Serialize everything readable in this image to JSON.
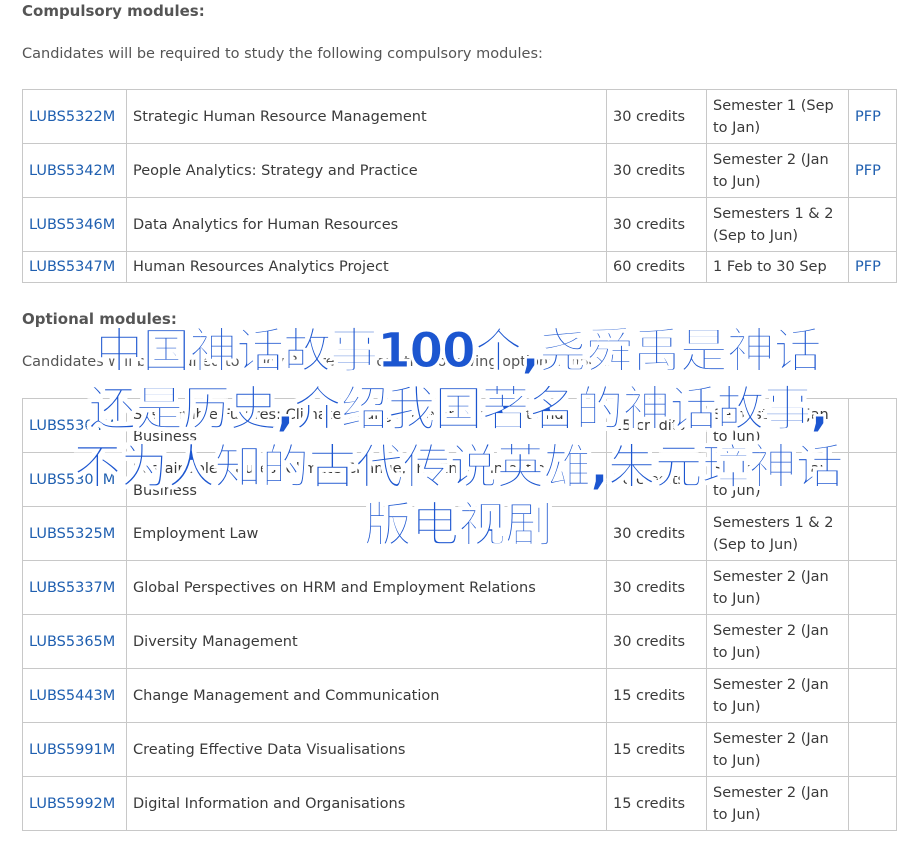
{
  "compulsory": {
    "heading": "Compulsory modules:",
    "intro": "Candidates will be required to study the following compulsory modules:",
    "rows": [
      {
        "code": "LUBS5322M",
        "title": "Strategic Human Resource Management",
        "credits": "30 credits",
        "semester": "Semester 1 (Sep to Jan)",
        "pfp": "PFP"
      },
      {
        "code": "LUBS5342M",
        "title": "People Analytics: Strategy and Practice",
        "credits": "30 credits",
        "semester": "Semester 2 (Jan to Jun)",
        "pfp": "PFP"
      },
      {
        "code": "LUBS5346M",
        "title": "Data Analytics for Human Resources",
        "credits": "30 credits",
        "semester": "Semesters 1 & 2 (Sep to Jun)",
        "pfp": ""
      },
      {
        "code": "LUBS5347M",
        "title": "Human Resources Analytics Project",
        "credits": "60 credits",
        "semester": "1 Feb to 30 Sep",
        "pfp": "PFP"
      }
    ]
  },
  "optional": {
    "heading": "Optional modules:",
    "intro": "Candidates will be required to study 30 credits from the following optional modules:",
    "rows": [
      {
        "code": "LUBS5304M",
        "title": "Sustainable Futures: Climate Change, the Environment and Business",
        "credits": "15 credits",
        "semester": "Semester 1 (Jan to Jun)",
        "pfp": ""
      },
      {
        "code": "LUBS5305M",
        "title": "Sustainable Futures: Climate Change, the Environment and Business",
        "credits": "30 credits",
        "semester": "Semester 2 (Jan to Jun)",
        "pfp": ""
      },
      {
        "code": "LUBS5325M",
        "title": "Employment Law",
        "credits": "30 credits",
        "semester": "Semesters 1 & 2 (Sep to Jun)",
        "pfp": ""
      },
      {
        "code": "LUBS5337M",
        "title": "Global Perspectives on HRM and Employment Relations",
        "credits": "30 credits",
        "semester": "Semester 2 (Jan to Jun)",
        "pfp": ""
      },
      {
        "code": "LUBS5365M",
        "title": "Diversity Management",
        "credits": "30 credits",
        "semester": "Semester 2 (Jan to Jun)",
        "pfp": ""
      },
      {
        "code": "LUBS5443M",
        "title": "Change Management and Communication",
        "credits": "15 credits",
        "semester": "Semester 2 (Jan to Jun)",
        "pfp": ""
      },
      {
        "code": "LUBS5991M",
        "title": "Creating Effective Data Visualisations",
        "credits": "15 credits",
        "semester": "Semester 2 (Jan to Jun)",
        "pfp": ""
      },
      {
        "code": "LUBS5992M",
        "title": "Digital Information and Organisations",
        "credits": "15 credits",
        "semester": "Semester 2 (Jan to Jun)",
        "pfp": ""
      }
    ]
  },
  "overlay": {
    "lines": [
      "中国神话故事100个,尧舜禹是神话",
      "还是历史,介绍我国著名的神话故事,",
      "不为人知的古代传说英雄,朱元璋神话",
      "版电视剧"
    ]
  },
  "colors": {
    "link": "#1f5fb0",
    "overlay_text": "#1c56d0",
    "border": "#c8c8c8"
  }
}
